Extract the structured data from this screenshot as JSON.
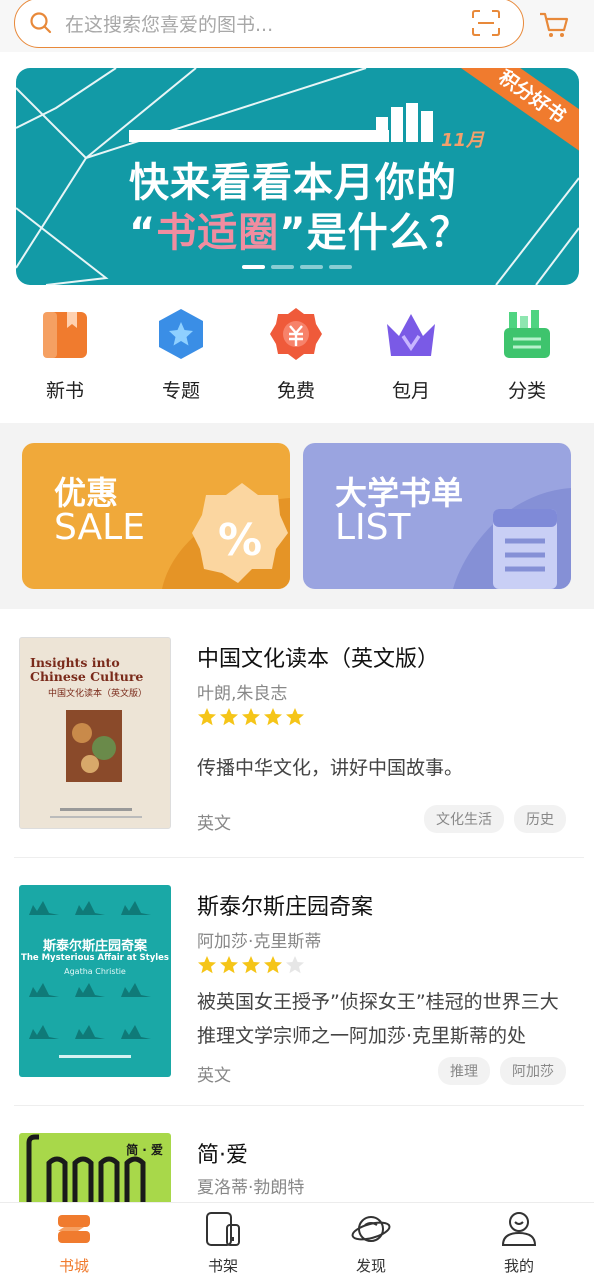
{
  "search": {
    "placeholder": "在这搜索您喜爱的图书..."
  },
  "banner": {
    "ribbon": "积分好书",
    "month": "11月",
    "line1": "快来看看本月你的",
    "line2_quote_open": "“",
    "line2_highlight": "书适圈",
    "line2_quote_close": "”",
    "line2_rest": "是什么？",
    "active_slide": 1,
    "slide_count": 4
  },
  "categories": [
    {
      "label": "新书",
      "icon": "new-book-icon",
      "color": "#f07b2e"
    },
    {
      "label": "专题",
      "icon": "topic-star-icon",
      "color": "#3a8ee6"
    },
    {
      "label": "免费",
      "icon": "free-yuan-icon",
      "color": "#ef5a3a"
    },
    {
      "label": "包月",
      "icon": "crown-icon",
      "color": "#7a5ae6"
    },
    {
      "label": "分类",
      "icon": "category-box-icon",
      "color": "#3ec46d"
    }
  ],
  "promos": {
    "sale": {
      "title": "优惠",
      "subtitle": "SALE",
      "color": "#f0a93a"
    },
    "list": {
      "title": "大学书单",
      "subtitle": "LIST",
      "color": "#9aa4e0"
    }
  },
  "books": [
    {
      "title": "中国文化读本（英文版）",
      "author": "叶朗,朱良志",
      "rating": 5,
      "desc": "传播中华文化，讲好中国故事。",
      "lang": "英文",
      "tags": [
        "文化生活",
        "历史"
      ],
      "cover": {
        "title_en": "Insights into Chinese Culture",
        "title_cn": "中国文化读本（英文版）"
      }
    },
    {
      "title": "斯泰尔斯庄园奇案",
      "author": "阿加莎·克里斯蒂",
      "rating": 4,
      "desc": "被英国女王授予”侦探女王”桂冠的世界三大推理文学宗师之一阿加莎·克里斯蒂的处",
      "lang": "英文",
      "tags": [
        "推理",
        "阿加莎"
      ],
      "cover": {
        "title_cn": "斯泰尔斯庄园奇案",
        "title_en": "The Mysterious Affair at Styles",
        "author_en": "Agatha Christie"
      }
    },
    {
      "title": "简·爱",
      "author": "夏洛蒂·勃朗特",
      "cover": {
        "title_cn": "简 · 爱"
      }
    }
  ],
  "nav": [
    {
      "label": "书城",
      "icon": "bookstore-icon",
      "active": true
    },
    {
      "label": "书架",
      "icon": "bookshelf-icon",
      "active": false
    },
    {
      "label": "发现",
      "icon": "discover-planet-icon",
      "active": false
    },
    {
      "label": "我的",
      "icon": "profile-icon",
      "active": false
    }
  ],
  "colors": {
    "accent": "#f07b2e",
    "banner_bg": "#129aa6",
    "star": "#f5c518"
  }
}
